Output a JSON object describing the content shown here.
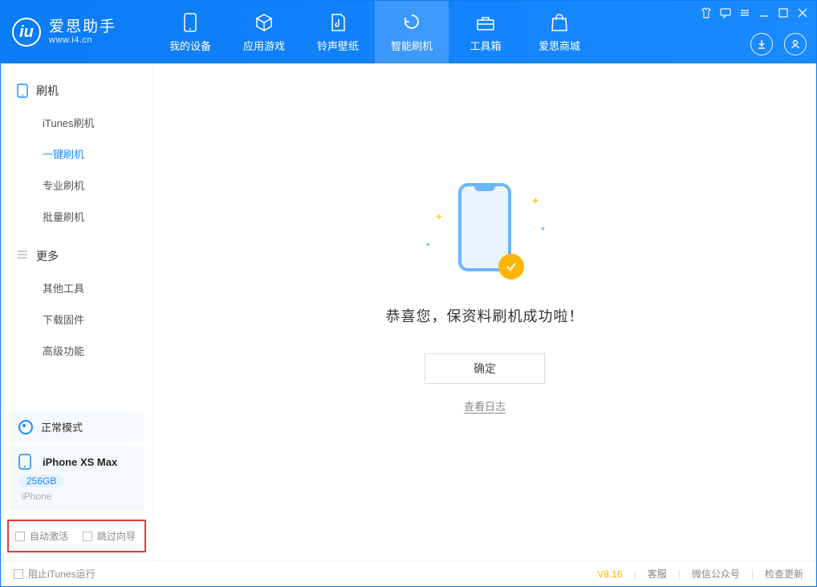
{
  "brand": {
    "name": "爱思助手",
    "url": "www.i4.cn"
  },
  "nav": {
    "device": "我的设备",
    "apps": "应用游戏",
    "ring": "铃声壁纸",
    "flash": "智能刷机",
    "tools": "工具箱",
    "store": "爱思商城"
  },
  "sidebar": {
    "group_flash": "刷机",
    "items_flash": {
      "itunes": "iTunes刷机",
      "oneclick": "一键刷机",
      "pro": "专业刷机",
      "batch": "批量刷机"
    },
    "group_more": "更多",
    "items_more": {
      "other": "其他工具",
      "firmware": "下载固件",
      "adv": "高级功能"
    }
  },
  "mode": {
    "label": "正常模式"
  },
  "device": {
    "name": "iPhone XS Max",
    "capacity": "256GB",
    "type": "iPhone"
  },
  "options": {
    "auto_activate": "自动激活",
    "skip_guide": "跳过向导"
  },
  "main": {
    "success_msg": "恭喜您，保资料刷机成功啦！",
    "ok": "确定",
    "view_log": "查看日志"
  },
  "status": {
    "block_itunes": "阻止iTunes运行",
    "version": "V8.16",
    "support": "客服",
    "wechat": "微信公众号",
    "update": "检查更新"
  }
}
